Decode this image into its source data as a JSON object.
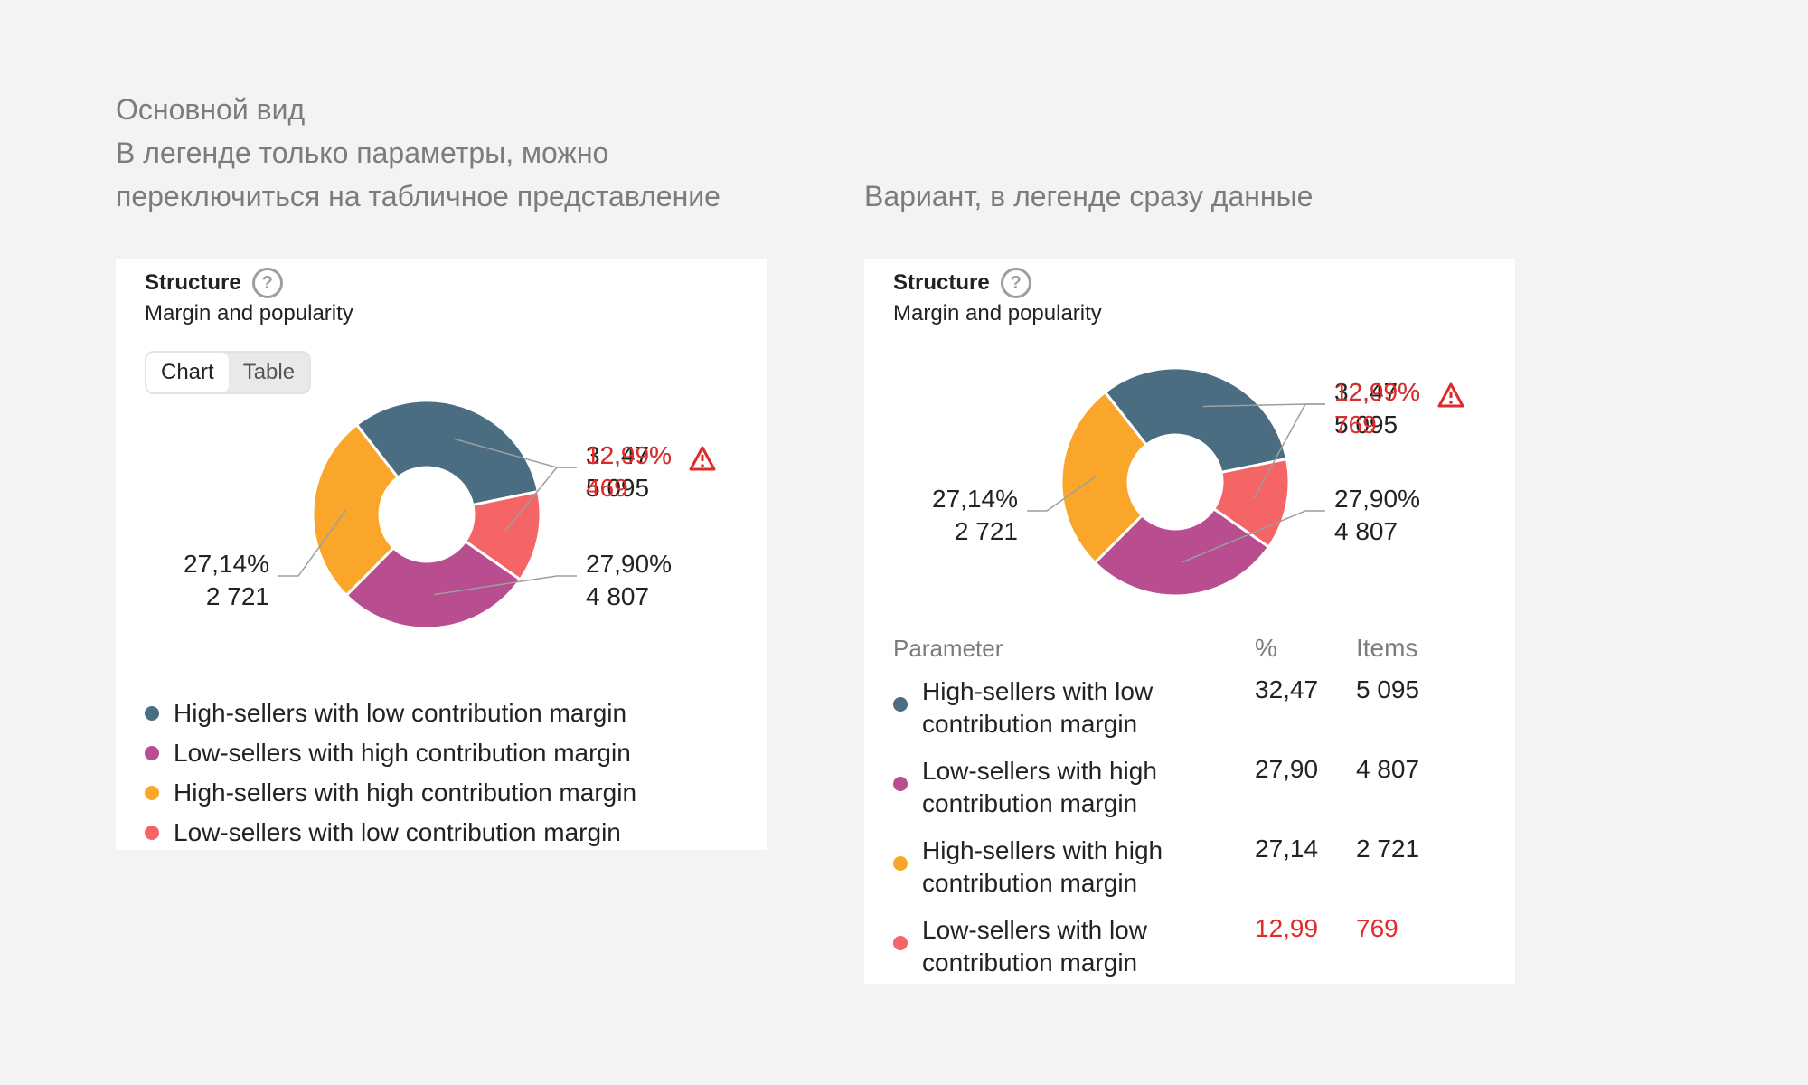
{
  "captions": {
    "left": [
      "Основной вид",
      "В легенде только параметры, можно",
      "переключиться на табличное представление"
    ],
    "right": [
      "Вариант, в легенде сразу данные"
    ]
  },
  "colors": {
    "slate": "#4a6d82",
    "plum": "#b84d8f",
    "orange": "#faa62b",
    "coral": "#f56565",
    "warning": "#e02b2b"
  },
  "cards": [
    {
      "title": "Structure",
      "help_icon": "question-circle-icon",
      "subtitle": "Margin and popularity",
      "toggle": {
        "options": [
          "Chart",
          "Table"
        ],
        "selected": "Chart"
      }
    },
    {
      "title": "Structure",
      "help_icon": "question-circle-icon",
      "subtitle": "Margin and popularity",
      "table_headers": [
        "Parameter",
        "%",
        "Items"
      ]
    }
  ],
  "chart_data": [
    {
      "type": "pie",
      "donut": true,
      "segments": [
        {
          "label": "High-sellers with low contribution margin",
          "percent": 32.47,
          "percent_label": "32,47%",
          "items": 5095,
          "items_label": "5 095",
          "color": "#4a6d82",
          "warning": false
        },
        {
          "label": "Low-sellers with low contribution margin",
          "percent": 12.99,
          "percent_label": "12,99%",
          "items": 469,
          "items_label": "469",
          "color": "#f56565",
          "warning": true
        },
        {
          "label": "Low-sellers with high contribution margin",
          "percent": 27.9,
          "percent_label": "27,90%",
          "items": 4807,
          "items_label": "4 807",
          "color": "#b84d8f",
          "warning": false
        },
        {
          "label": "High-sellers with high contribution margin",
          "percent": 27.14,
          "percent_label": "27,14%",
          "items": 2721,
          "items_label": "2 721",
          "color": "#faa62b",
          "warning": false
        }
      ],
      "legend": [
        {
          "label": "High-sellers with low contribution margin",
          "color": "#4a6d82"
        },
        {
          "label": "Low-sellers with high contribution margin",
          "color": "#b84d8f"
        },
        {
          "label": "High-sellers with high contribution margin",
          "color": "#faa62b"
        },
        {
          "label": "Low-sellers with low contribution margin",
          "color": "#f56565"
        }
      ]
    },
    {
      "type": "pie",
      "donut": true,
      "segments": [
        {
          "label": "High-sellers with low contribution margin",
          "percent": 32.47,
          "percent_label": "32,47%",
          "items": 5095,
          "items_label": "5 095",
          "color": "#4a6d82",
          "warning": false
        },
        {
          "label": "Low-sellers with low contribution margin",
          "percent": 12.99,
          "percent_label": "12,99%",
          "items": 769,
          "items_label": "769",
          "color": "#f56565",
          "warning": true
        },
        {
          "label": "Low-sellers with high contribution margin",
          "percent": 27.9,
          "percent_label": "27,90%",
          "items": 4807,
          "items_label": "4 807",
          "color": "#b84d8f",
          "warning": false
        },
        {
          "label": "High-sellers with high contribution margin",
          "percent": 27.14,
          "percent_label": "27,14%",
          "items": 2721,
          "items_label": "2 721",
          "color": "#faa62b",
          "warning": false
        }
      ],
      "table_rows": [
        {
          "label": "High-sellers with low contribution margin",
          "percent_label": "32,47",
          "items_label": "5 095",
          "color": "#4a6d82",
          "warning": false
        },
        {
          "label": "Low-sellers with high contribution margin",
          "percent_label": "27,90",
          "items_label": "4 807",
          "color": "#b84d8f",
          "warning": false
        },
        {
          "label": "High-sellers with high contribution margin",
          "percent_label": "27,14",
          "items_label": "2 721",
          "color": "#faa62b",
          "warning": false
        },
        {
          "label": "Low-sellers with low contribution margin",
          "percent_label": "12,99",
          "items_label": "769",
          "color": "#f56565",
          "warning": true
        }
      ]
    }
  ]
}
